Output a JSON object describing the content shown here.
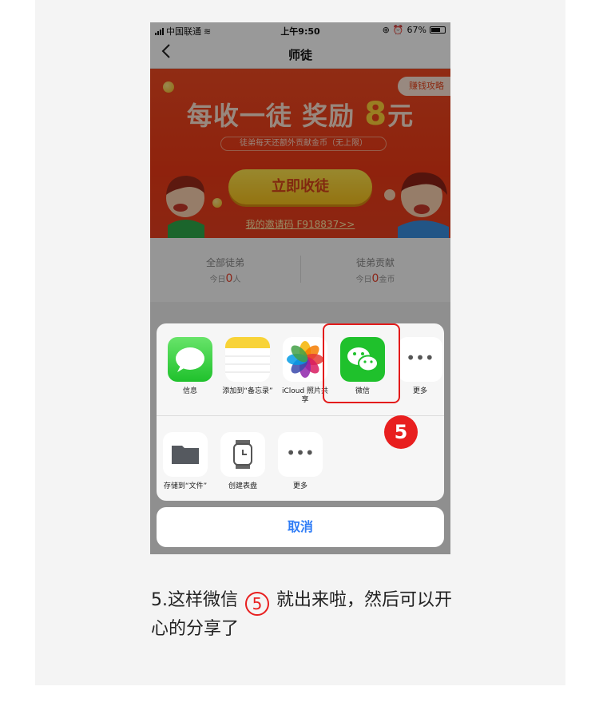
{
  "status_bar": {
    "carrier": "中国联通",
    "time": "上午9:50",
    "battery": "67%"
  },
  "nav": {
    "title": "师徒",
    "back_icon": "chevron-left-icon"
  },
  "banner": {
    "strategy_label": "赚钱攻略",
    "headline_prefix": "每收一徒 奖励 ",
    "headline_number": "8",
    "headline_suffix": "元",
    "subline": "徒弟每天还额外贡献金币（无上限）",
    "cta": "立即收徒",
    "invite": "我的邀请码  F918837>>"
  },
  "stats": [
    {
      "title": "全部徒弟",
      "prefix": "今日",
      "value": "0",
      "unit": "人"
    },
    {
      "title": "徒弟贡献",
      "prefix": "今日",
      "value": "0",
      "unit": "金币"
    }
  ],
  "share_sheet": {
    "row1": [
      {
        "label": "信息",
        "icon": "messages-icon"
      },
      {
        "label": "添加到“备忘录”",
        "icon": "notes-icon"
      },
      {
        "label": "iCloud 照片共享",
        "icon": "photos-icon"
      },
      {
        "label": "微信",
        "icon": "wechat-icon"
      },
      {
        "label": "更多",
        "icon": "more-icon"
      }
    ],
    "row2": [
      {
        "label": "存储到“文件”",
        "icon": "folder-icon"
      },
      {
        "label": "创建表盘",
        "icon": "watch-icon"
      },
      {
        "label": "更多",
        "icon": "more-icon"
      }
    ],
    "cancel": "取消"
  },
  "step_badge": "5",
  "caption": {
    "before": "5.这样微信 ",
    "circle": "5",
    "after": " 就出来啦，然后可以开心的分享了"
  },
  "colors": {
    "accent_red": "#e81f1f",
    "banner_orange": "#ee3a16",
    "wechat_green": "#1fc12c",
    "link_blue": "#2f7cf6"
  }
}
